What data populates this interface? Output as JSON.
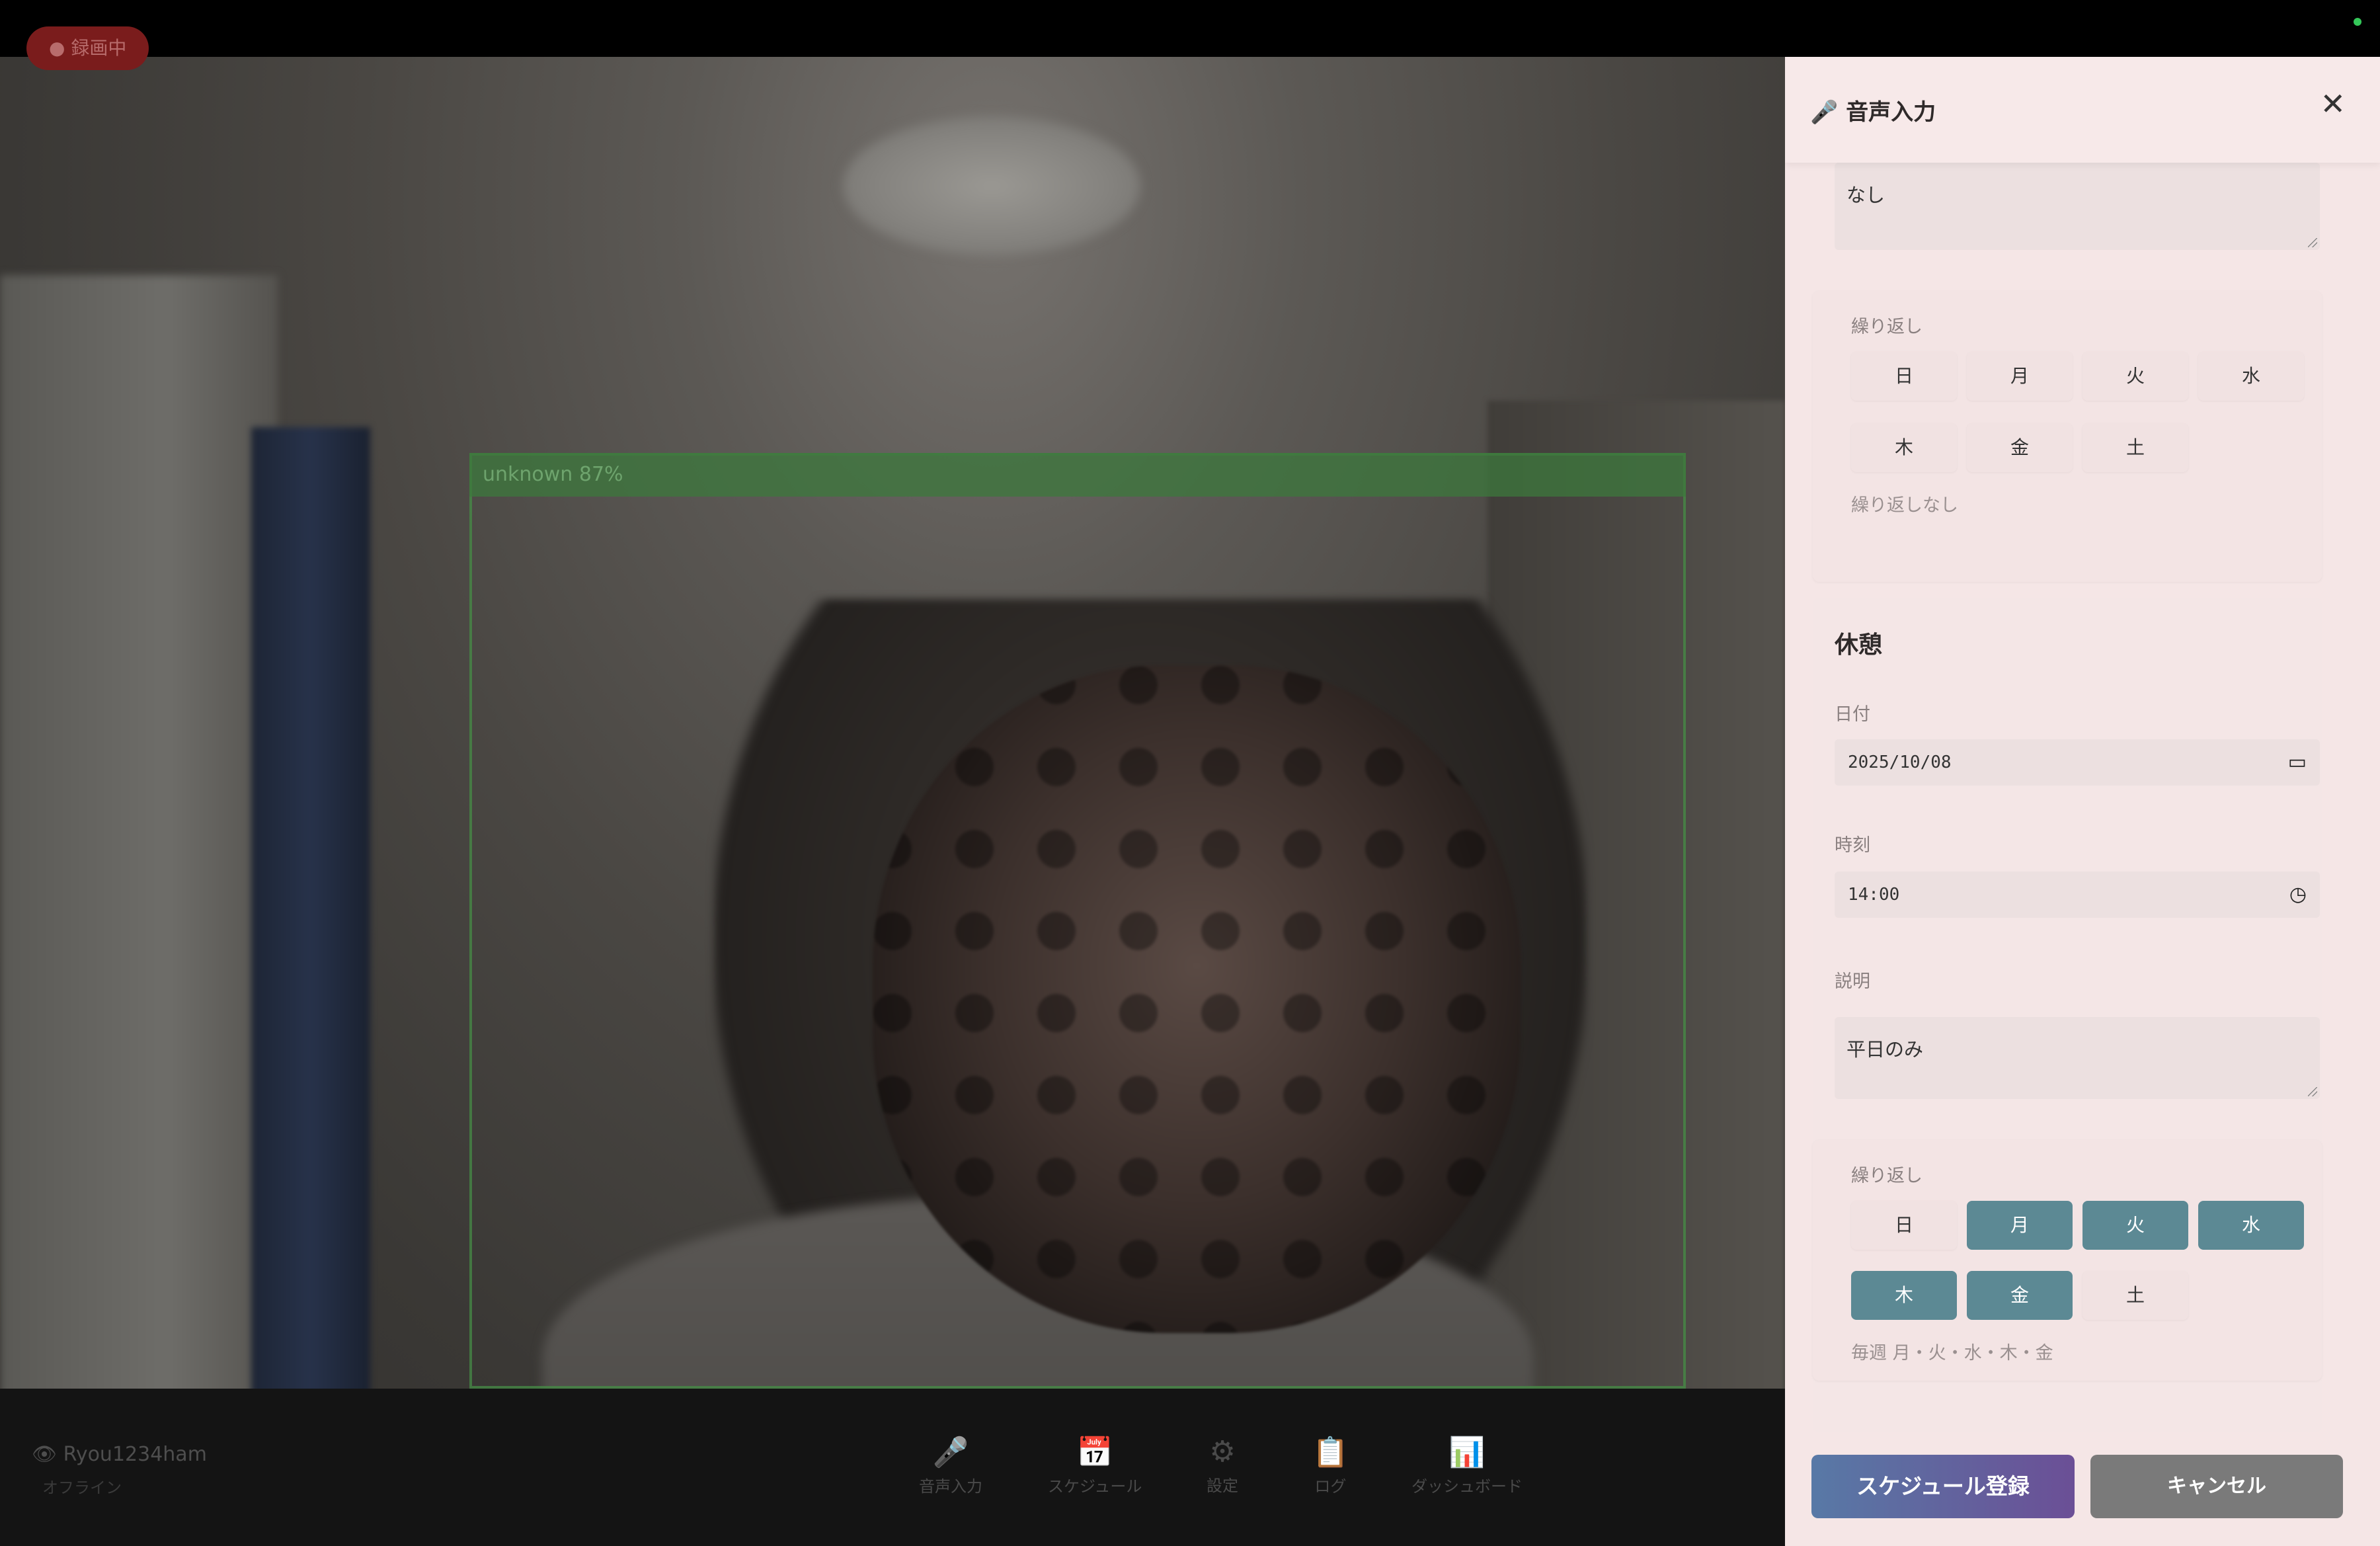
{
  "background": {
    "detection_label": "unknown 87%",
    "rec_badge": "● 録画中",
    "user_name": "👁 Ryou1234ham",
    "user_sub": "オフライン",
    "toolbar": [
      {
        "icon": "microphone-icon",
        "glyph": "🎤",
        "label": "音声入力"
      },
      {
        "icon": "calendar-icon",
        "glyph": "📅",
        "label": "スケジュール"
      },
      {
        "icon": "gear-icon",
        "glyph": "⚙",
        "label": "設定"
      },
      {
        "icon": "log-icon",
        "glyph": "📋",
        "label": "ログ"
      },
      {
        "icon": "dashboard-icon",
        "glyph": "📊",
        "label": "ダッシュボード"
      }
    ]
  },
  "panel": {
    "title": "🎤 音声入力",
    "close_glyph": "✕",
    "previous_item": {
      "description_value": "なし",
      "repeat_label": "繰り返し",
      "days": [
        {
          "label": "日",
          "selected": false
        },
        {
          "label": "月",
          "selected": false
        },
        {
          "label": "火",
          "selected": false
        },
        {
          "label": "水",
          "selected": false
        },
        {
          "label": "木",
          "selected": false
        },
        {
          "label": "金",
          "selected": false
        },
        {
          "label": "土",
          "selected": false
        }
      ],
      "repeat_summary": "繰り返しなし"
    },
    "break_section": {
      "title": "休憩",
      "date_label": "日付",
      "date_value": "2025/10/08",
      "time_label": "時刻",
      "time_value": "14:00",
      "description_label": "説明",
      "description_value": "平日のみ",
      "repeat_label": "繰り返し",
      "days": [
        {
          "label": "日",
          "selected": false
        },
        {
          "label": "月",
          "selected": true
        },
        {
          "label": "火",
          "selected": true
        },
        {
          "label": "水",
          "selected": true
        },
        {
          "label": "木",
          "selected": true
        },
        {
          "label": "金",
          "selected": true
        },
        {
          "label": "土",
          "selected": false
        }
      ],
      "repeat_summary": "毎週 月・火・水・木・金"
    },
    "buttons": {
      "submit": "スケジュール登録",
      "cancel": "キャンセル"
    }
  },
  "colors": {
    "panel_bg": "#f5e6e6",
    "day_selected": "#5c8994",
    "primary_gradient_start": "#5879a6",
    "primary_gradient_end": "#6b4f96",
    "cancel_bg": "#7a7a7a"
  }
}
